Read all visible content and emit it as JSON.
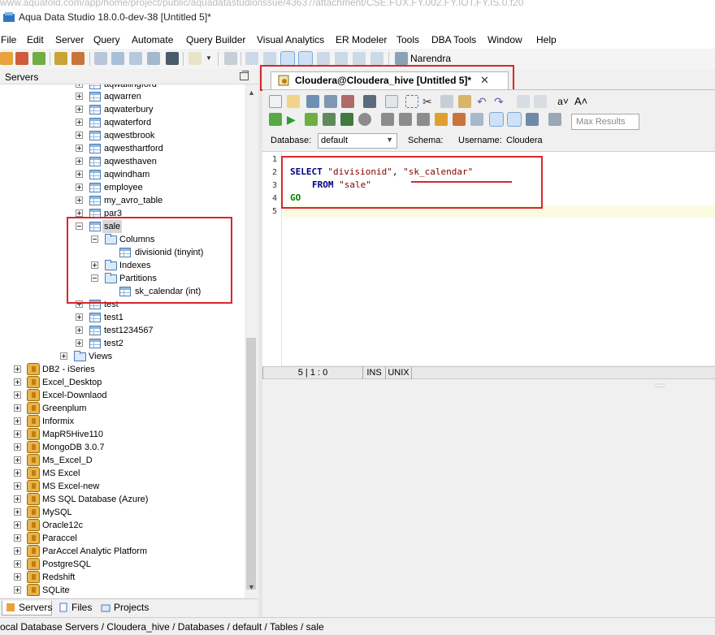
{
  "window": {
    "url_strip": "www.aquafold.com/app/home/project/public/aquadatastudio/issue/43637/attachment/CSE.FUX.FY.002.FY.IOT.FY.IS.0.f20",
    "title": "Aqua Data Studio 18.0.0-dev-38 [Untitled 5]*"
  },
  "menubar": {
    "items": [
      "File",
      "Edit",
      "Server",
      "Query",
      "Automate",
      "Query Builder",
      "Visual Analytics",
      "ER Modeler",
      "Tools",
      "DBA Tools",
      "Window",
      "Help"
    ]
  },
  "toolbar": {
    "user": "Narendra"
  },
  "servers_panel": {
    "title": "Servers",
    "tree": {
      "partial_top": "aqwallingford",
      "tables_before": [
        "aqwarren",
        "aqwaterbury",
        "aqwaterford",
        "aqwestbrook",
        "aqwesthartford",
        "aqwesthaven",
        "aqwindham",
        "employee",
        "my_avro_table",
        "par3"
      ],
      "selected_table": "sale",
      "columns_folder": "Columns",
      "column_item": "divisionid (tinyint)",
      "indexes_folder": "Indexes",
      "partitions_folder": "Partitions",
      "partition_item": "sk_calendar (int)",
      "tables_after": [
        "test",
        "test1",
        "test1234567",
        "test2"
      ],
      "views_folder": "Views",
      "servers": [
        "DB2 - iSeries",
        "Excel_Desktop",
        "Excel-Downlaod",
        "Greenplum",
        "Informix",
        "MapR5Hive110",
        "MongoDB 3.0.7",
        "Ms_Excel_D",
        "MS Excel",
        "MS Excel-new",
        "MS SQL Database (Azure)",
        "MySQL",
        "Oracle12c",
        "Paraccel",
        "ParAccel Analytic Platform",
        "PostgreSQL",
        "Redshift",
        "SQLite"
      ]
    },
    "bottom_tabs": [
      "Servers",
      "Files",
      "Projects"
    ]
  },
  "editor": {
    "tab_label": "Cloudera@Cloudera_hive [Untitled 5]*",
    "database_label": "Database:",
    "database_value": "default",
    "schema_label": "Schema:",
    "username_label": "Username:",
    "username_value": "Cloudera",
    "max_results_placeholder": "Max Results",
    "line_numbers": [
      "1",
      "2",
      "3",
      "4",
      "5"
    ],
    "code": {
      "line2_kw": "SELECT",
      "line2_str1": "\"divisionid\"",
      "line2_comma": ",",
      "line2_str2": "\"sk_calendar\"",
      "line3_kw": "FROM",
      "line3_str": "\"sale\"",
      "line4_kw": "GO"
    },
    "status": {
      "position": "5 | 1 : 0",
      "mode": "INS",
      "line_endings": "UNIX"
    }
  },
  "statusbar": {
    "path": "ocal Database Servers / Cloudera_hive / Databases / default / Tables / sale"
  },
  "colors": {
    "annotation_red": "#d9262c",
    "keyword_blue": "#00007f",
    "keyword_green": "#008000",
    "string_red": "#7f0000"
  }
}
